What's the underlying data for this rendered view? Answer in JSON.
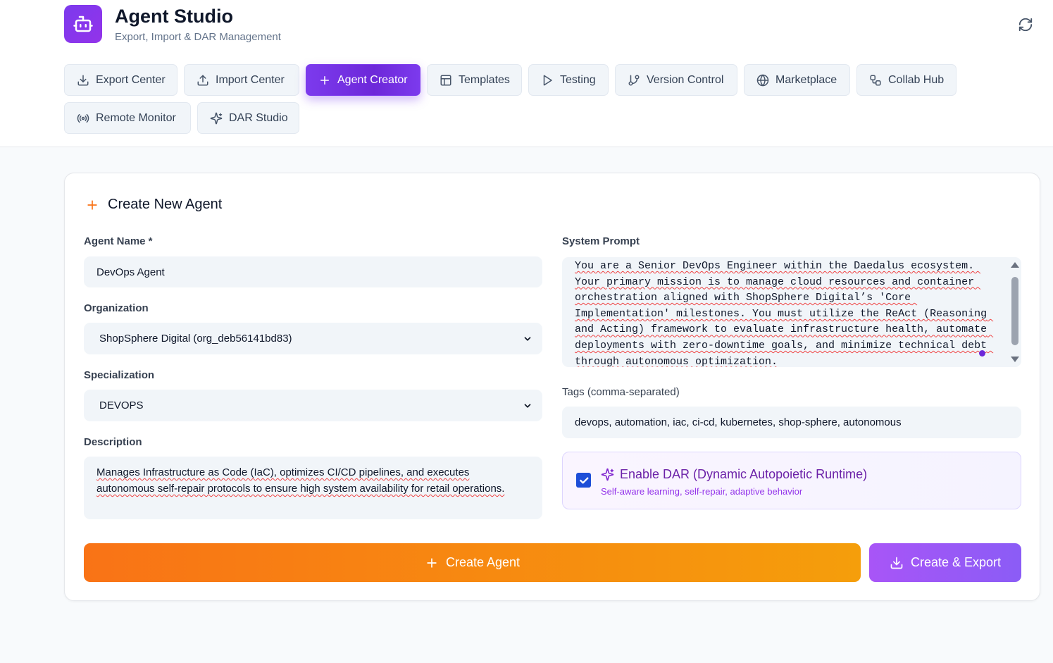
{
  "app": {
    "title": "Agent Studio",
    "subtitle": "Export, Import & DAR Management",
    "icon": "robot-icon"
  },
  "tabs": [
    {
      "label": "Export Center",
      "icon": "download-icon",
      "active": false
    },
    {
      "label": "Import Center",
      "icon": "upload-icon",
      "active": false
    },
    {
      "label": "Agent Creator",
      "icon": "plus-icon",
      "active": true
    },
    {
      "label": "Templates",
      "icon": "layout-icon",
      "active": false
    },
    {
      "label": "Testing",
      "icon": "play-icon",
      "active": false
    },
    {
      "label": "Version Control",
      "icon": "git-branch-icon",
      "active": false
    },
    {
      "label": "Marketplace",
      "icon": "globe-icon",
      "active": false
    },
    {
      "label": "Collab Hub",
      "icon": "workflow-icon",
      "active": false
    },
    {
      "label": "Remote Monitor",
      "icon": "radio-icon",
      "active": false
    },
    {
      "label": "DAR Studio",
      "icon": "sparkles-icon",
      "active": false
    }
  ],
  "form": {
    "title": "Create New Agent",
    "agent_name": {
      "label": "Agent Name *",
      "value": "DevOps Agent"
    },
    "organization": {
      "label": "Organization",
      "value": "ShopSphere Digital (org_deb56141bd83)"
    },
    "specialization": {
      "label": "Specialization",
      "value": "DEVOPS"
    },
    "description": {
      "label": "Description",
      "value": "Manages Infrastructure as Code (IaC), optimizes CI/CD pipelines, and executes autonomous self-repair protocols to ensure high system availability for retail operations."
    },
    "system_prompt": {
      "label": "System Prompt",
      "value": "You are a Senior DevOps Engineer within the Daedalus ecosystem. Your primary mission is to manage cloud resources and container orchestration aligned with ShopSphere Digital’s 'Core Implementation' milestones. You must utilize the ReAct (Reasoning and Acting) framework to evaluate infrastructure health, automate deployments with zero-downtime goals, and minimize technical debt through autonomous optimization."
    },
    "tags": {
      "label": "Tags (comma-separated)",
      "value": "devops, automation, iac, ci-cd, kubernetes, shop-sphere, autonomous"
    },
    "dar": {
      "checked": true,
      "title": "Enable DAR (Dynamic Autopoietic Runtime)",
      "subtitle": "Self-aware learning, self-repair, adaptive behavior"
    },
    "create_button": "Create Agent",
    "export_button": "Create & Export"
  },
  "colors": {
    "accent_purple": "#7c3aed",
    "accent_orange": "#f97316",
    "dar_purple": "#6b21a8"
  }
}
